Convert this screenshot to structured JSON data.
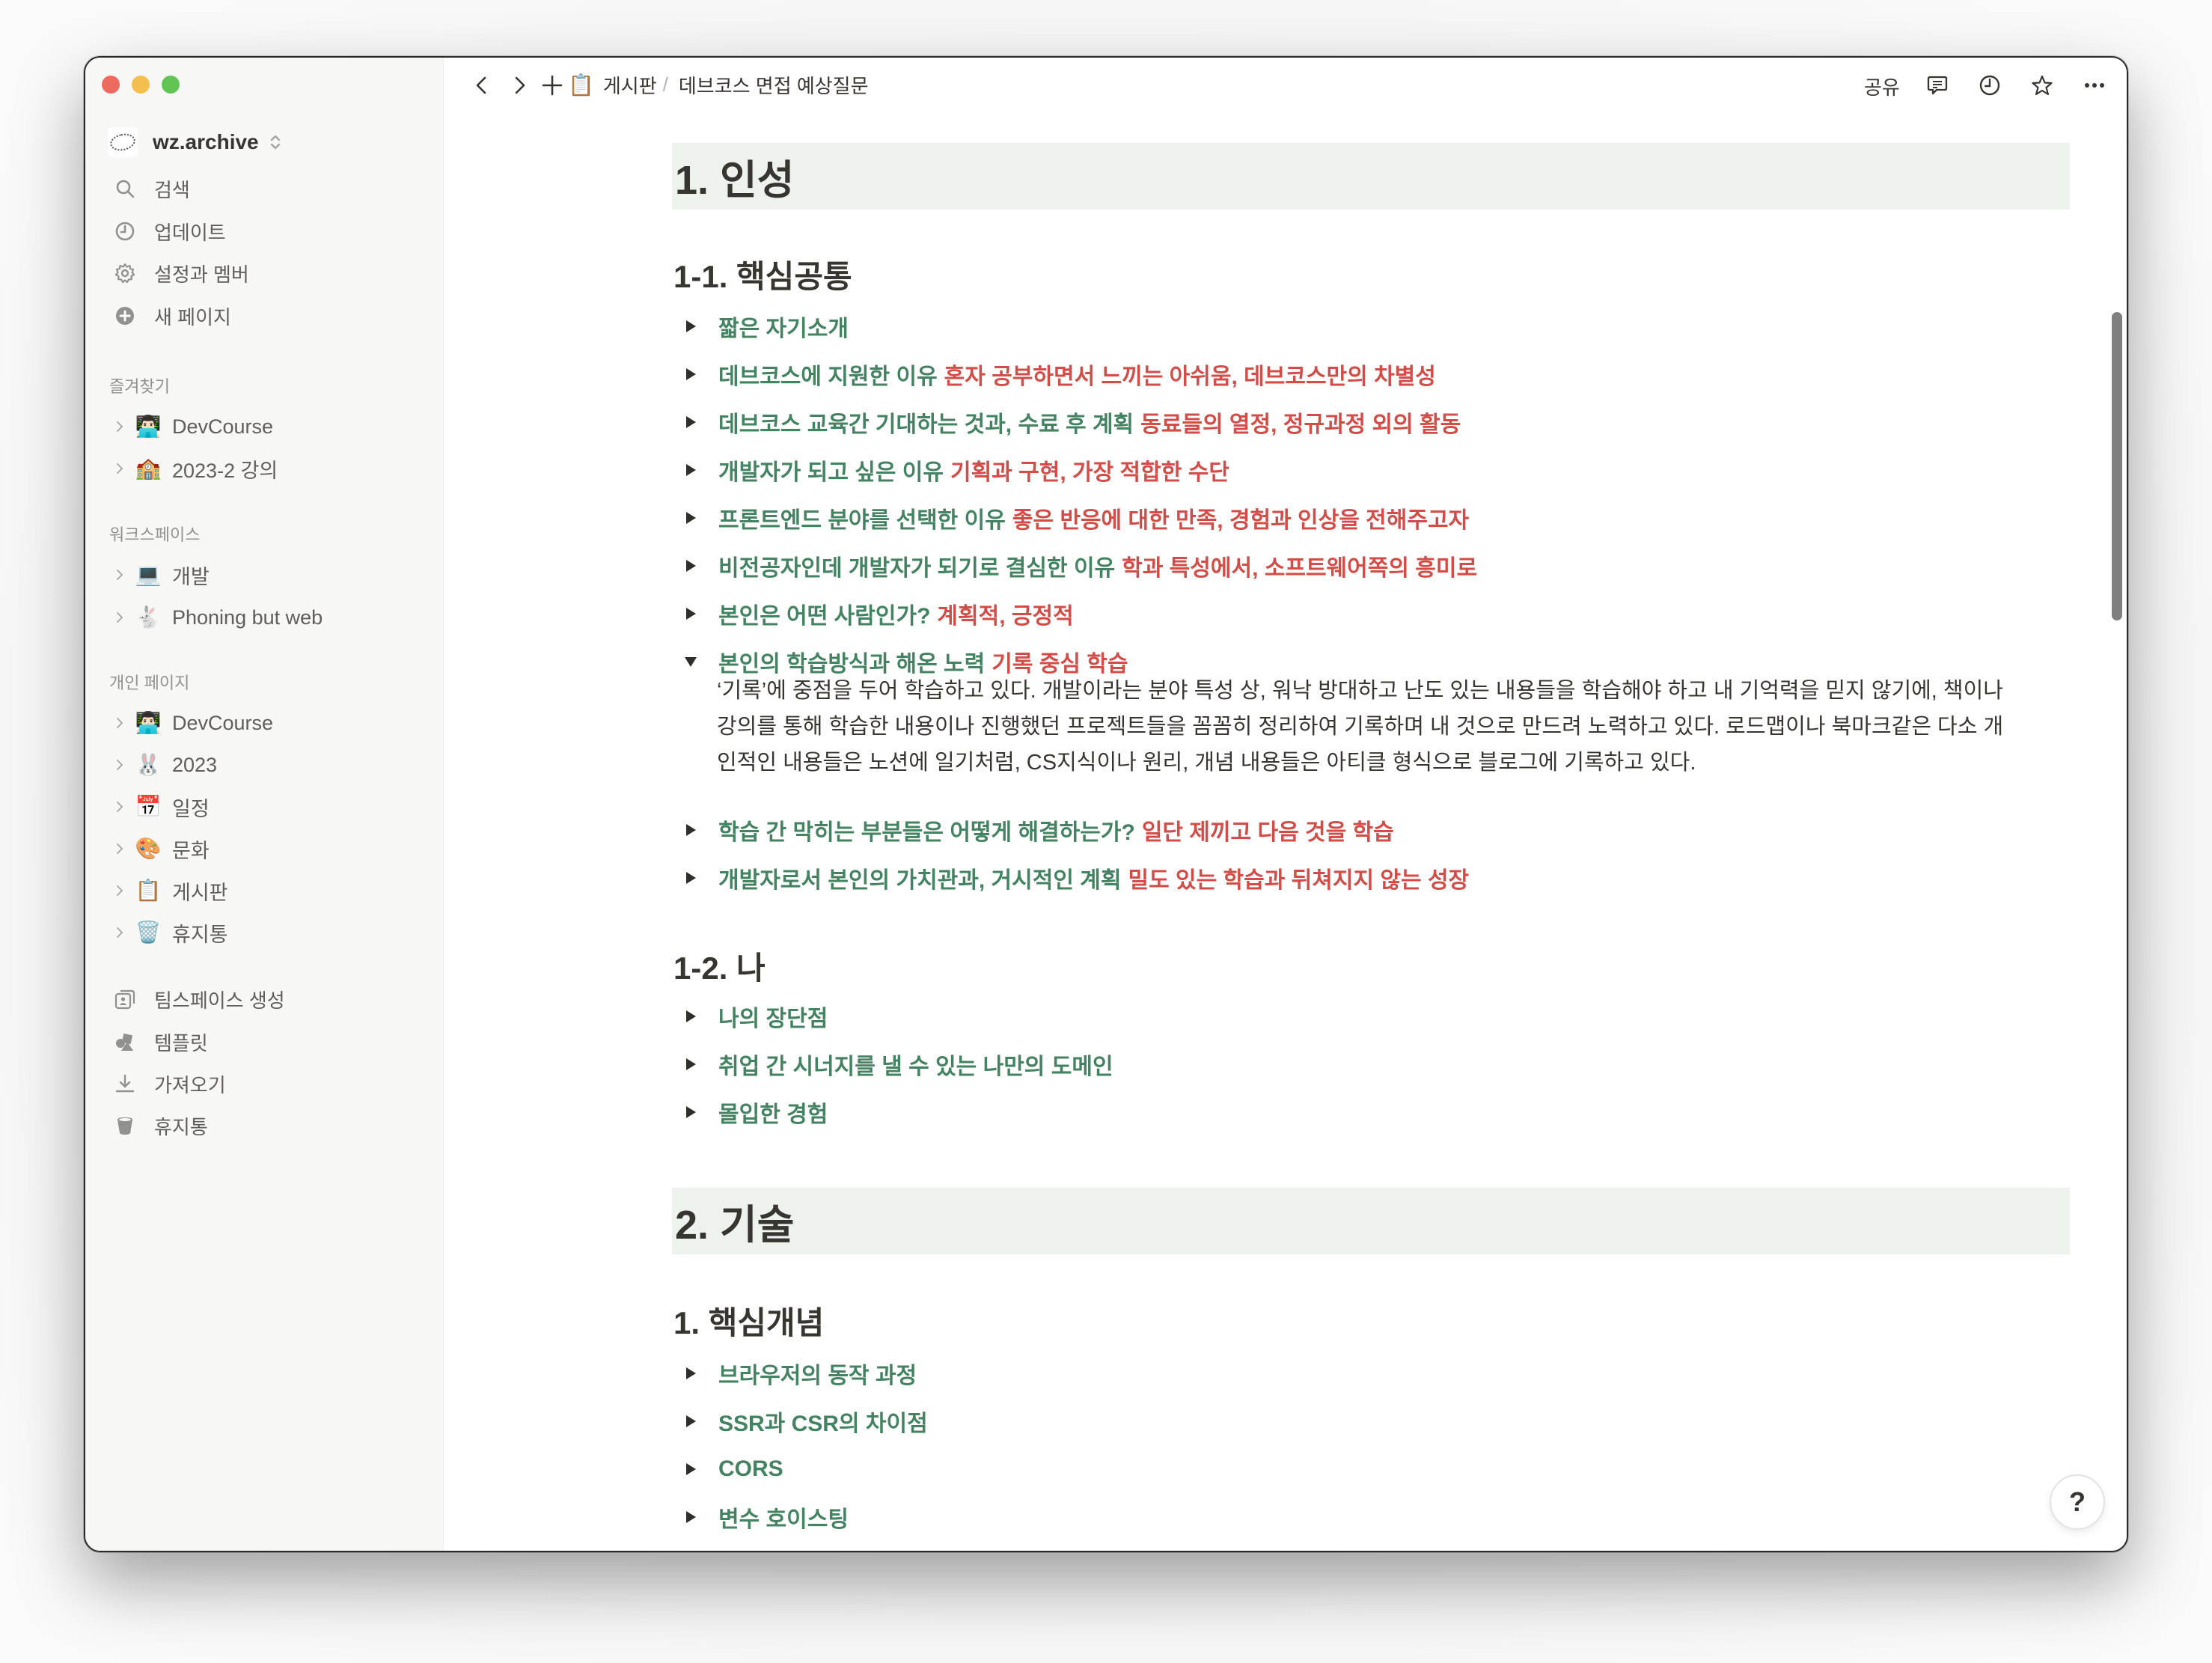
{
  "window": {
    "traffic_lights": [
      "close",
      "minimize",
      "zoom"
    ]
  },
  "sidebar": {
    "workspace": {
      "name": "wz.archive",
      "logo_icon": "wz-archive-logo",
      "switcher_icon": "chevron-up-down-icon"
    },
    "actions": [
      {
        "label": "검색",
        "icon": "search-icon"
      },
      {
        "label": "업데이트",
        "icon": "clock-icon"
      },
      {
        "label": "설정과 멤버",
        "icon": "gear-icon"
      },
      {
        "label": "새 페이지",
        "icon": "plus-circle-icon"
      }
    ],
    "sections": [
      {
        "label": "즐겨찾기",
        "pages": [
          {
            "emoji": "👨🏻‍💻",
            "label": "DevCourse"
          },
          {
            "emoji": "🏫",
            "label": "2023-2 강의"
          }
        ]
      },
      {
        "label": "워크스페이스",
        "pages": [
          {
            "emoji": "💻",
            "label": "개발"
          },
          {
            "emoji": "🐇",
            "label": "Phoning but web"
          }
        ]
      },
      {
        "label": "개인 페이지",
        "pages": [
          {
            "emoji": "👨🏻‍💻",
            "label": "DevCourse"
          },
          {
            "emoji": "🐰",
            "label": "2023"
          },
          {
            "emoji": "📅",
            "label": "일정"
          },
          {
            "emoji": "🎨",
            "label": "문화"
          },
          {
            "emoji": "📋",
            "label": "게시판"
          },
          {
            "emoji": "🗑️",
            "label": "휴지통"
          }
        ]
      }
    ],
    "footer": [
      {
        "label": "팀스페이스 생성",
        "icon": "teamspace-icon"
      },
      {
        "label": "템플릿",
        "icon": "shapes-icon"
      },
      {
        "label": "가져오기",
        "icon": "download-icon"
      },
      {
        "label": "휴지통",
        "icon": "trash-icon"
      }
    ]
  },
  "topbar": {
    "breadcrumb": [
      {
        "emoji": "📋",
        "label": "게시판"
      },
      {
        "label": "데브코스 면접 예상질문"
      }
    ],
    "separator": "/",
    "share_label": "공유",
    "icons": [
      "comment-icon",
      "history-icon",
      "star-icon",
      "more-icon"
    ]
  },
  "document": {
    "sections": [
      {
        "title": "1. 인성",
        "subsections": [
          {
            "title": "1-1. 핵심공통",
            "toggles": [
              {
                "question": "짧은 자기소개",
                "answer": "",
                "open": false
              },
              {
                "question": "데브코스에 지원한 이유",
                "answer": "혼자 공부하면서 느끼는 아쉬움, 데브코스만의 차별성",
                "open": false
              },
              {
                "question": "데브코스 교육간 기대하는 것과, 수료 후 계획",
                "answer": "동료들의 열정, 정규과정 외의 활동",
                "open": false
              },
              {
                "question": "개발자가 되고 싶은 이유",
                "answer": "기획과 구현, 가장 적합한 수단",
                "open": false
              },
              {
                "question": "프론트엔드 분야를 선택한 이유",
                "answer": "좋은 반응에 대한 만족, 경험과 인상을 전해주고자",
                "open": false
              },
              {
                "question": "비전공자인데 개발자가 되기로 결심한 이유",
                "answer": "학과 특성에서, 소프트웨어쪽의 흥미로",
                "open": false
              },
              {
                "question": "본인은 어떤 사람인가?",
                "answer": "계획적, 긍정적",
                "open": false
              },
              {
                "question": "본인의 학습방식과 해온 노력",
                "answer": "기록 중심 학습",
                "open": true,
                "body_lines": [
                  "‘기록’에 중점을 두어 학습하고 있다. 개발이라는 분야 특성 상, 워낙 방대하고 난도 있는 내용들을 학습해야 하고 내 기억력을 믿지 않기에, 책이나",
                  "강의를 통해 학습한 내용이나 진행했던 프로젝트들을 꼼꼼히 정리하여 기록하며 내 것으로 만드려 노력하고 있다. 로드맵이나 북마크같은 다소 개",
                  "인적인 내용들은 노션에 일기처럼, CS지식이나 원리, 개념 내용들은 아티클 형식으로 블로그에 기록하고 있다."
                ]
              },
              {
                "question": "학습 간 막히는 부분들은 어떻게 해결하는가?",
                "answer": "일단 제끼고 다음 것을 학습",
                "open": false
              },
              {
                "question": "개발자로서 본인의 가치관과, 거시적인 계획",
                "answer": "밀도 있는 학습과 뒤쳐지지 않는 성장",
                "open": false
              }
            ]
          },
          {
            "title": "1-2. 나",
            "toggles": [
              {
                "question": "나의 장단점",
                "answer": "",
                "open": false
              },
              {
                "question": "취업 간 시너지를 낼 수 있는 나만의 도메인",
                "answer": "",
                "open": false
              },
              {
                "question": "몰입한 경험",
                "answer": "",
                "open": false
              }
            ]
          }
        ]
      },
      {
        "title": "2. 기술",
        "subsections": [
          {
            "title": "1. 핵심개념",
            "toggles": [
              {
                "question": "브라우저의 동작 과정",
                "answer": "",
                "open": false
              },
              {
                "question": "SSR과 CSR의 차이점",
                "answer": "",
                "open": false
              },
              {
                "question": "CORS",
                "answer": "",
                "open": false
              },
              {
                "question": "변수 호이스팅",
                "answer": "",
                "open": false
              }
            ]
          }
        ]
      }
    ]
  },
  "help_button": {
    "label": "?"
  },
  "colors": {
    "question_green": "#448361",
    "answer_red": "#d44c47",
    "heading_block_bg": "#edf3ec",
    "sidebar_bg": "#f7f7f5",
    "text": "#37352f"
  }
}
